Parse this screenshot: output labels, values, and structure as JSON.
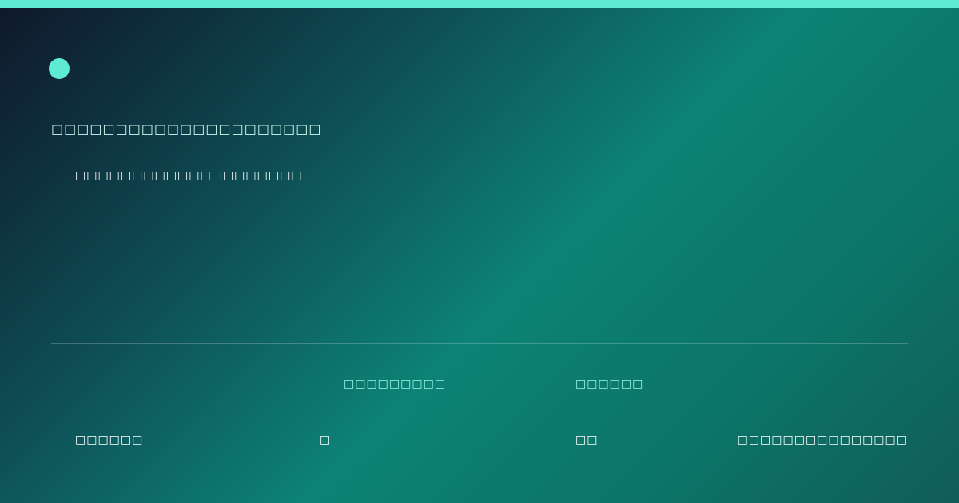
{
  "colors": {
    "accent": "#5eead4",
    "gradient_dark": "#0f172a",
    "gradient_teal": "#0d8276"
  },
  "header": {
    "headline": "□□□□□□□□□□□□□□□□□□□□□",
    "subline": "□□□□□□□□□□□□□□□□□□□□"
  },
  "footer": {
    "labels": [
      "□□□□□□□□□",
      "□□□□□□"
    ],
    "values": [
      "□□□□□□",
      "□",
      "□□",
      "□□□□□□□□□□□□□□□"
    ]
  }
}
